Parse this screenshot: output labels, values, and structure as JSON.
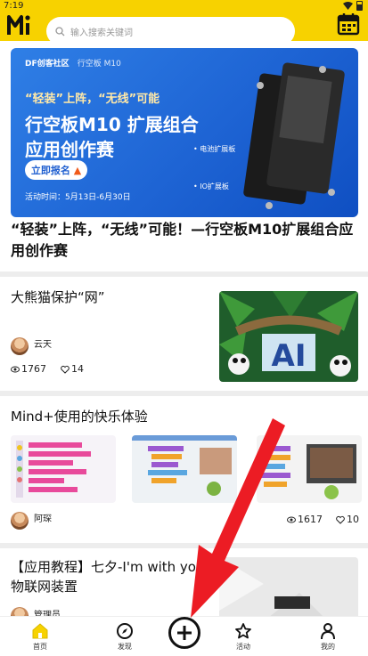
{
  "status": {
    "time": "7:19"
  },
  "search": {
    "placeholder": "输入搜索关键词"
  },
  "banner": {
    "brand": "DF创客社区",
    "brand_sub": "行空板 M10",
    "line1": "“轻装”上阵，“无线”可能",
    "line2": "行空板M10 扩展组合",
    "line3": "应用创作赛",
    "signup": "立即报名",
    "date": "活动时间：5月13日-6月30日",
    "label_battery": "电池扩展板",
    "label_io": "IO扩展板"
  },
  "feature": {
    "title": "“轻装”上阵，“无线”可能！—行空板M10扩展组合应用创作赛"
  },
  "posts": [
    {
      "title": "大熊猫保护“网”",
      "author": "云天",
      "views": "1767",
      "likes": "14"
    },
    {
      "title": "Mind+使用的快乐体验",
      "author": "阿琛",
      "views": "1617",
      "likes": "10"
    },
    {
      "title": "【应用教程】七夕-I'm with you 物联网装置",
      "author": "管理员"
    }
  ],
  "nav": [
    {
      "label": "首页"
    },
    {
      "label": "发现"
    },
    {
      "label": "活动"
    },
    {
      "label": "我的"
    }
  ],
  "colors": {
    "accent": "#f7d200",
    "banner": "#1e64d4",
    "arrow": "#ec1c24"
  }
}
